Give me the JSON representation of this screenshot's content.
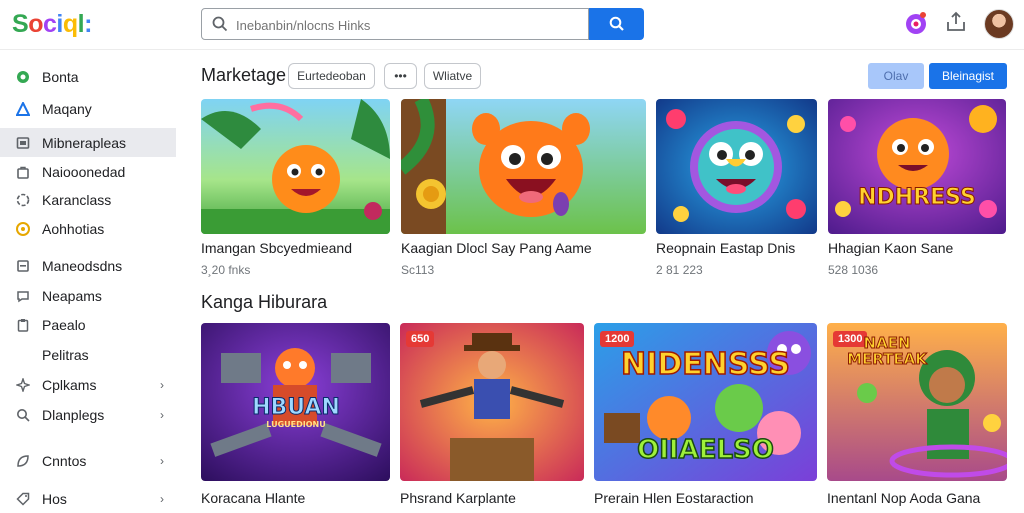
{
  "app": {
    "logo": "Sociql:"
  },
  "search": {
    "placeholder": "Inebanbin/nlocns Hinks"
  },
  "sidebar": {
    "items": [
      {
        "label": "Bonta",
        "icon": "green-circle-icon",
        "color": "#34a853"
      },
      {
        "label": "Maqany",
        "icon": "triangle-icon",
        "color": "#1a73e8"
      },
      {
        "label": "Mibnerapleas",
        "icon": "store-icon",
        "color": "#5f6368",
        "active": true
      },
      {
        "label": "Naiooonedad",
        "icon": "bag-icon",
        "color": "#5f6368"
      },
      {
        "label": "Karanclass",
        "icon": "spinner-icon",
        "color": "#5f6368"
      },
      {
        "label": "Aohhotias",
        "icon": "coin-icon",
        "color": "#e6a700"
      },
      {
        "label": "Maneodsdns",
        "icon": "square-icon",
        "color": "#5f6368"
      },
      {
        "label": "Neapams",
        "icon": "chat-icon",
        "color": "#5f6368"
      },
      {
        "label": "Paealo",
        "icon": "clipboard-icon",
        "color": "#5f6368"
      },
      {
        "label": "Pelitras",
        "icon": "",
        "color": "#5f6368"
      },
      {
        "label": "Cplkams",
        "icon": "sparkle-icon",
        "color": "#5f6368",
        "chevron": "›"
      },
      {
        "label": "Dlanplegs",
        "icon": "search-icon",
        "color": "#5f6368",
        "chevron": "›"
      },
      {
        "label": "Cnntos",
        "icon": "leaf-icon",
        "color": "#5f6368",
        "chevron": "›"
      },
      {
        "label": "Hos",
        "icon": "tag-icon",
        "color": "#5f6368",
        "chevron": "›"
      }
    ]
  },
  "main": {
    "title": "Marketage",
    "chips": [
      "Eurtedeoban",
      "•••",
      "Wliatve"
    ],
    "btn_light": "Olav",
    "btn_primary": "Bleinagist",
    "row1": [
      {
        "title": "Imangan Sbcyedmieand",
        "meta": "3¸20 fnks"
      },
      {
        "title": "Kaagian Dlocl Say Pang Aame",
        "meta": "Sc113"
      },
      {
        "title": "Reopnain Eastap Dnis",
        "meta": "2 81 223"
      },
      {
        "title": "Hhagian Kaon Sane",
        "meta": "528 1036",
        "poster": "NDHRESS"
      }
    ],
    "section2": "Kanga Hiburara",
    "row2": [
      {
        "title": "Koracana Hlante",
        "poster": "HBUAN",
        "poster_sub": "LUGUEDIONU"
      },
      {
        "title": "Phsrand Karplante",
        "badge": "650"
      },
      {
        "title": "Prerain Hlen Eostaraction",
        "badge": "1200",
        "poster": "NIDENSSS",
        "poster_sub": "OIIAELSO"
      },
      {
        "title": "Inentanl Nop Aoda Gana",
        "badge": "1300",
        "poster": "NAEN MERTEAK"
      }
    ]
  },
  "colors": {
    "accent": "#1a73e8",
    "accent_light": "#a8c7fa",
    "badge": "#e53935"
  }
}
